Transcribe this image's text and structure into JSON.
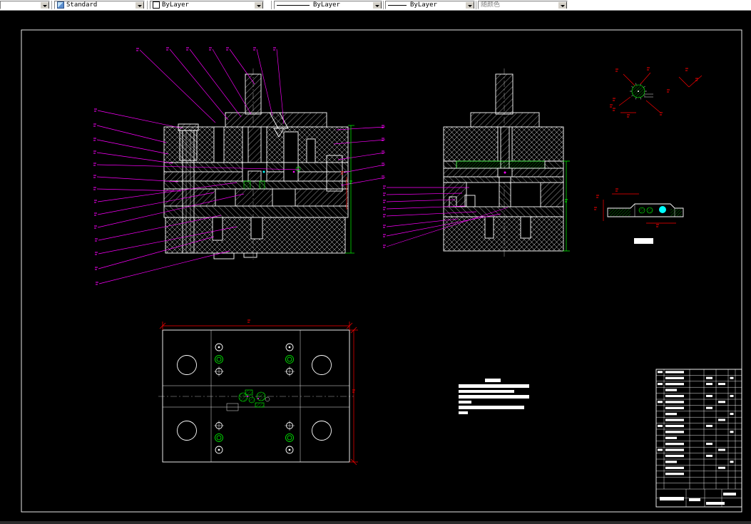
{
  "toolbar": {
    "layer_combo": {
      "value": ""
    },
    "style_combo": {
      "value": "Standard"
    },
    "color_combo": {
      "value": "ByLayer"
    },
    "linetype_combo": {
      "value": "ByLayer"
    },
    "lineweight_combo": {
      "value": "ByLayer"
    },
    "plotstyle_combo": {
      "value": "随颜色"
    }
  },
  "colors": {
    "canvas_background": "#000000",
    "drawing_line": "#ffffff",
    "leader": "#ff00ff",
    "dim_green": "#00ff00",
    "dim_red": "#ff0000",
    "accent_cyan": "#00ffff",
    "toolbar_background": "#ffffff",
    "disabled_text": "#808080"
  }
}
